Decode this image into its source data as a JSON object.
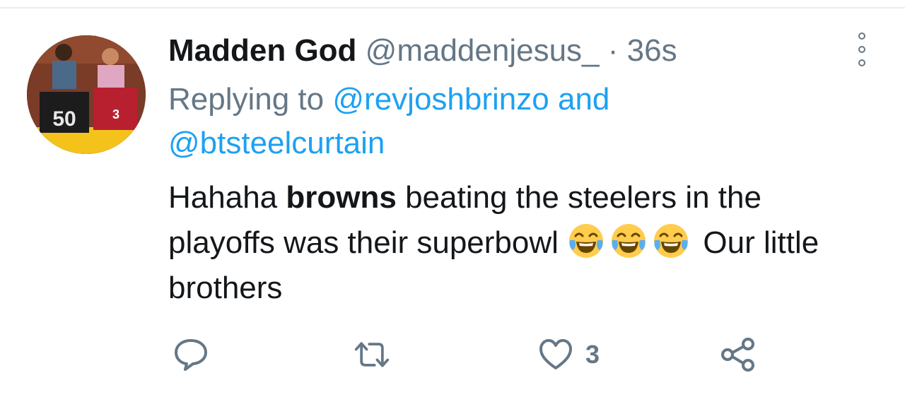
{
  "tweet": {
    "display_name": "Madden God",
    "handle": "@maddenjesus_",
    "separator": "·",
    "time": "36s",
    "reply_prefix": "Replying to",
    "reply_to_1": "@revjoshbrinzo",
    "reply_and": "and",
    "reply_to_2": "@btsteelcurtain",
    "text_part1": "Hahaha",
    "text_bold": "browns",
    "text_part2": "beating the steelers in the playoffs was their superbowl",
    "emoji_name": "face-with-tears-of-joy",
    "emoji_count": 3,
    "text_part3": "Our little brothers"
  },
  "actions": {
    "reply_icon": "comment-icon",
    "retweet_icon": "retweet-icon",
    "like_icon": "heart-icon",
    "like_count": "3",
    "share_icon": "share-icon"
  },
  "colors": {
    "link": "#1da1f2",
    "secondary_text": "#657786",
    "primary_text": "#14171a"
  }
}
